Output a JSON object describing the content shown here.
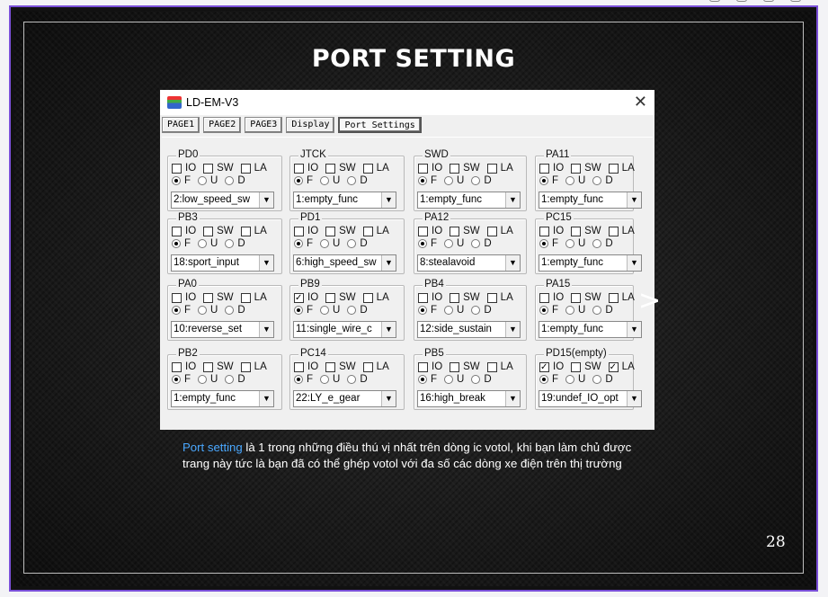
{
  "slide": {
    "title": "PORT SETTING",
    "next_arrow": ">",
    "caption_highlight": "Port setting",
    "caption_text": " là 1 trong những điều thú vị nhất trên dòng ic votol, khi bạn làm chủ được trang này tức là bạn đã có thể ghép votol với đa số các dòng xe điện trên thị trường",
    "page_number": "28"
  },
  "window": {
    "title": "LD-EM-V3",
    "close_glyph": "✕",
    "tabs": [
      "PAGE1",
      "PAGE2",
      "PAGE3",
      "Display",
      "Port Settings"
    ],
    "active_tab": "Port Settings"
  },
  "labels": {
    "io": "IO",
    "sw": "SW",
    "la": "LA",
    "f": "F",
    "u": "U",
    "d": "D"
  },
  "ports": [
    {
      "name": "PD0",
      "io": false,
      "sw": false,
      "la": false,
      "mode": "F",
      "value": "2:low_speed_sw"
    },
    {
      "name": "JTCK",
      "io": false,
      "sw": false,
      "la": false,
      "mode": "F",
      "value": "1:empty_func"
    },
    {
      "name": "SWD",
      "io": false,
      "sw": false,
      "la": false,
      "mode": "F",
      "value": "1:empty_func"
    },
    {
      "name": "PA11",
      "io": false,
      "sw": false,
      "la": false,
      "mode": "F",
      "value": "1:empty_func"
    },
    {
      "name": "PB3",
      "io": false,
      "sw": false,
      "la": false,
      "mode": "F",
      "value": "18:sport_input"
    },
    {
      "name": "PD1",
      "io": false,
      "sw": false,
      "la": false,
      "mode": "F",
      "value": "6:high_speed_sw"
    },
    {
      "name": "PA12",
      "io": false,
      "sw": false,
      "la": false,
      "mode": "F",
      "value": "8:stealavoid"
    },
    {
      "name": "PC15",
      "io": false,
      "sw": false,
      "la": false,
      "mode": "F",
      "value": "1:empty_func"
    },
    {
      "name": "PA0",
      "io": false,
      "sw": false,
      "la": false,
      "mode": "F",
      "value": "10:reverse_set"
    },
    {
      "name": "PB9",
      "io": true,
      "sw": false,
      "la": false,
      "mode": "F",
      "value": "11:single_wire_c"
    },
    {
      "name": "PB4",
      "io": false,
      "sw": false,
      "la": false,
      "mode": "F",
      "value": "12:side_sustain"
    },
    {
      "name": "PA15",
      "io": false,
      "sw": false,
      "la": false,
      "mode": "F",
      "value": "1:empty_func"
    },
    {
      "name": "PB2",
      "io": false,
      "sw": false,
      "la": false,
      "mode": "F",
      "value": "1:empty_func"
    },
    {
      "name": "PC14",
      "io": false,
      "sw": false,
      "la": false,
      "mode": "F",
      "value": "22:LY_e_gear"
    },
    {
      "name": "PB5",
      "io": false,
      "sw": false,
      "la": false,
      "mode": "F",
      "value": "16:high_break"
    },
    {
      "name": "PD15(empty)",
      "io": true,
      "sw": false,
      "la": true,
      "mode": "F",
      "value": "19:undef_IO_opt"
    }
  ]
}
